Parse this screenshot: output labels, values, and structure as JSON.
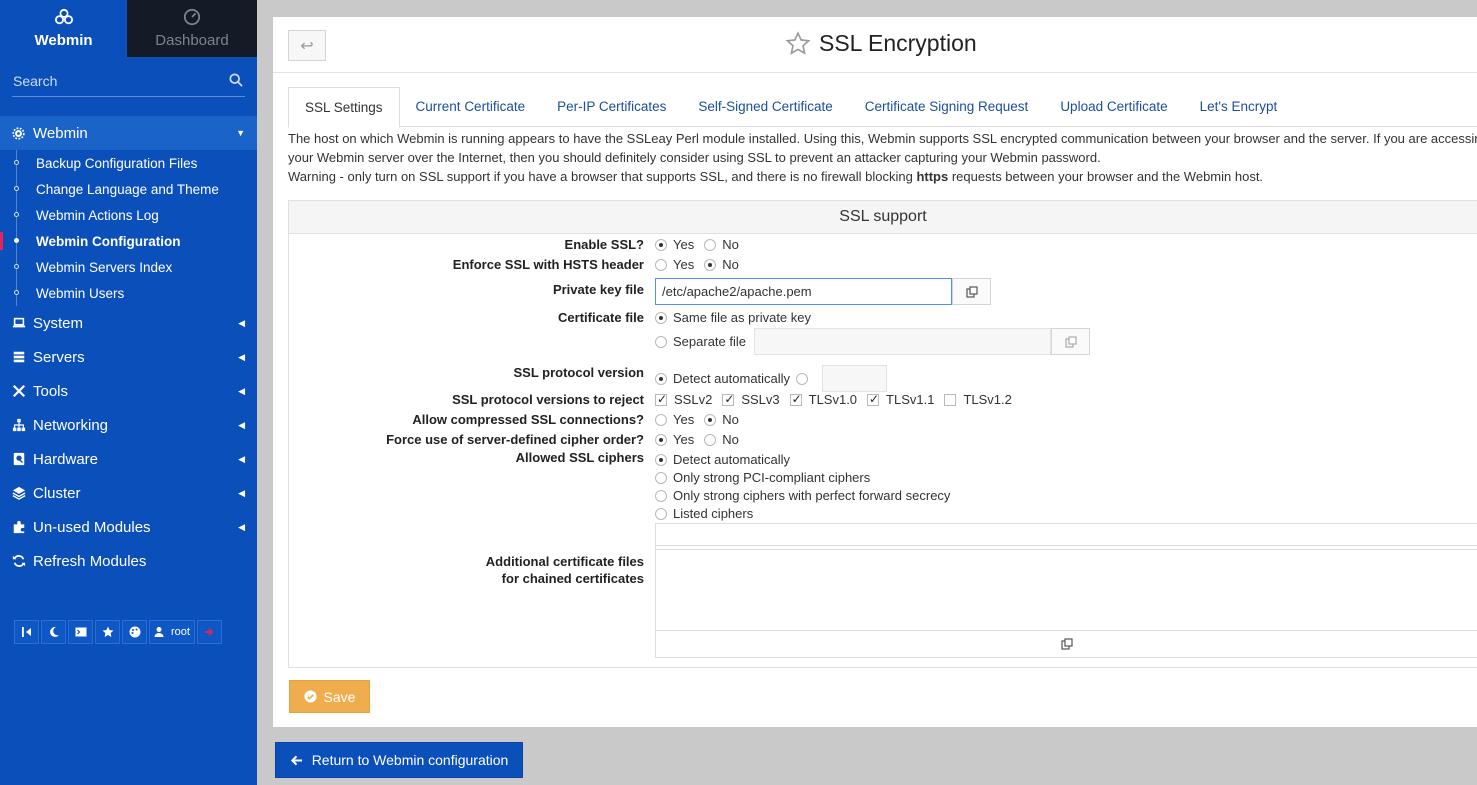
{
  "sidebar": {
    "top": {
      "webmin": "Webmin",
      "dashboard": "Dashboard"
    },
    "search_placeholder": "Search",
    "section_title": "Webmin",
    "webmin_items": [
      {
        "label": "Backup Configuration Files"
      },
      {
        "label": "Change Language and Theme"
      },
      {
        "label": "Webmin Actions Log"
      },
      {
        "label": "Webmin Configuration"
      },
      {
        "label": "Webmin Servers Index"
      },
      {
        "label": "Webmin Users"
      }
    ],
    "categories": [
      {
        "label": "System"
      },
      {
        "label": "Servers"
      },
      {
        "label": "Tools"
      },
      {
        "label": "Networking"
      },
      {
        "label": "Hardware"
      },
      {
        "label": "Cluster"
      },
      {
        "label": "Un-used Modules"
      },
      {
        "label": "Refresh Modules"
      }
    ],
    "user_label": "root"
  },
  "page": {
    "title": "SSL Encryption",
    "tabs": [
      {
        "label": "SSL Settings"
      },
      {
        "label": "Current Certificate"
      },
      {
        "label": "Per-IP Certificates"
      },
      {
        "label": "Self-Signed Certificate"
      },
      {
        "label": "Certificate Signing Request"
      },
      {
        "label": "Upload Certificate"
      },
      {
        "label": "Let's Encrypt"
      }
    ],
    "desc_line1": "The host on which Webmin is running appears to have the SSLeay Perl module installed. Using this, Webmin supports SSL encrypted communication between your browser and the server. If you are accessing",
    "desc_line2": "your Webmin server over the Internet, then you should definitely consider using SSL to prevent an attacker capturing your Webmin password.",
    "desc_warning_pre": "Warning - only turn on SSL support if you have a browser that supports SSL, and there is no firewall blocking ",
    "desc_warning_bold": "https",
    "desc_warning_post": " requests between your browser and the Webmin host."
  },
  "form": {
    "panel_title": "SSL support",
    "enable_ssl": {
      "label": "Enable SSL?",
      "yes": "Yes",
      "no": "No",
      "selected": "Yes"
    },
    "hsts": {
      "label": "Enforce SSL with HSTS header",
      "yes": "Yes",
      "no": "No",
      "selected": "No"
    },
    "private_key": {
      "label": "Private key file",
      "value": "/etc/apache2/apache.pem"
    },
    "certificate": {
      "label": "Certificate file",
      "same": "Same file as private key",
      "separate": "Separate file",
      "selected": "same",
      "separate_value": ""
    },
    "protocol_version": {
      "label": "SSL protocol version",
      "auto": "Detect automatically",
      "selected": "auto",
      "custom_value": ""
    },
    "reject_versions": {
      "label": "SSL protocol versions to reject",
      "options": [
        {
          "label": "SSLv2",
          "checked": true
        },
        {
          "label": "SSLv3",
          "checked": true
        },
        {
          "label": "TLSv1.0",
          "checked": true
        },
        {
          "label": "TLSv1.1",
          "checked": true
        },
        {
          "label": "TLSv1.2",
          "checked": false
        }
      ]
    },
    "compressed": {
      "label": "Allow compressed SSL connections?",
      "yes": "Yes",
      "no": "No",
      "selected": "No"
    },
    "cipher_order": {
      "label": "Force use of server-defined cipher order?",
      "yes": "Yes",
      "no": "No",
      "selected": "Yes"
    },
    "ciphers": {
      "label": "Allowed SSL ciphers",
      "options": [
        {
          "label": "Detect automatically",
          "selected": true
        },
        {
          "label": "Only strong PCI-compliant ciphers",
          "selected": false
        },
        {
          "label": "Only strong ciphers with perfect forward secrecy",
          "selected": false
        },
        {
          "label": "Listed ciphers",
          "selected": false
        }
      ],
      "listed_value": ""
    },
    "chain": {
      "label_line1": "Additional certificate files",
      "label_line2": "for chained certificates",
      "value": ""
    },
    "save_label": "Save"
  },
  "footer": {
    "return_label": "Return to Webmin configuration"
  },
  "colors": {
    "sidebar": "#0a4fba",
    "save": "#f0ad4e",
    "link": "#1d4d9e"
  }
}
